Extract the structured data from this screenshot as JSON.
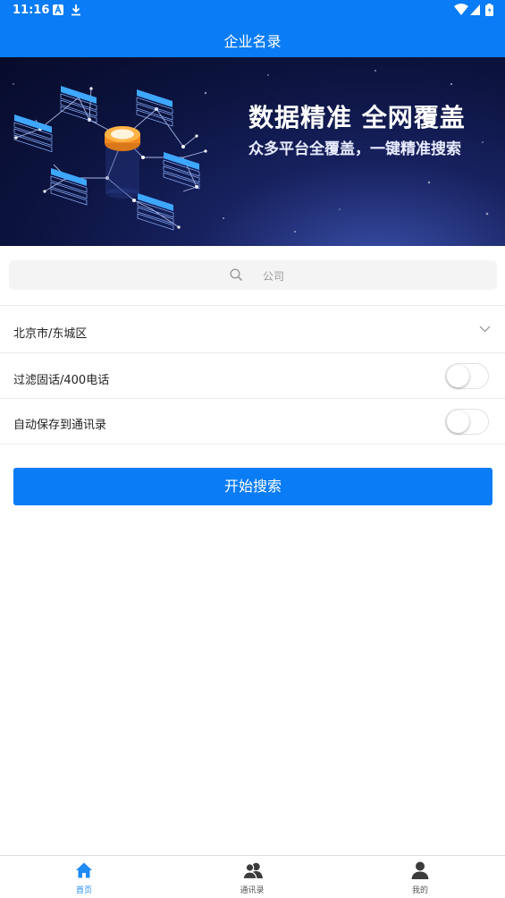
{
  "status_bar": {
    "time": "11:16"
  },
  "app_bar": {
    "title": "企业名录"
  },
  "banner": {
    "headline": "数据精准 全网覆盖",
    "subline": "众多平台全覆盖，一键精准搜索"
  },
  "search": {
    "placeholder": "公司"
  },
  "region": {
    "value": "北京市/东城区"
  },
  "options": {
    "filter_label": "过滤固话/400电话",
    "filter_on": false,
    "autosave_label": "自动保存到通讯录",
    "autosave_on": false
  },
  "start_button": {
    "label": "开始搜索"
  },
  "tabs": [
    {
      "label": "首页",
      "icon": "home-icon",
      "active": true
    },
    {
      "label": "通讯录",
      "icon": "contacts-icon",
      "active": false
    },
    {
      "label": "我的",
      "icon": "person-icon",
      "active": false
    }
  ],
  "colors": {
    "primary": "#0a7cf5",
    "tab_active": "#1f8bf5"
  }
}
